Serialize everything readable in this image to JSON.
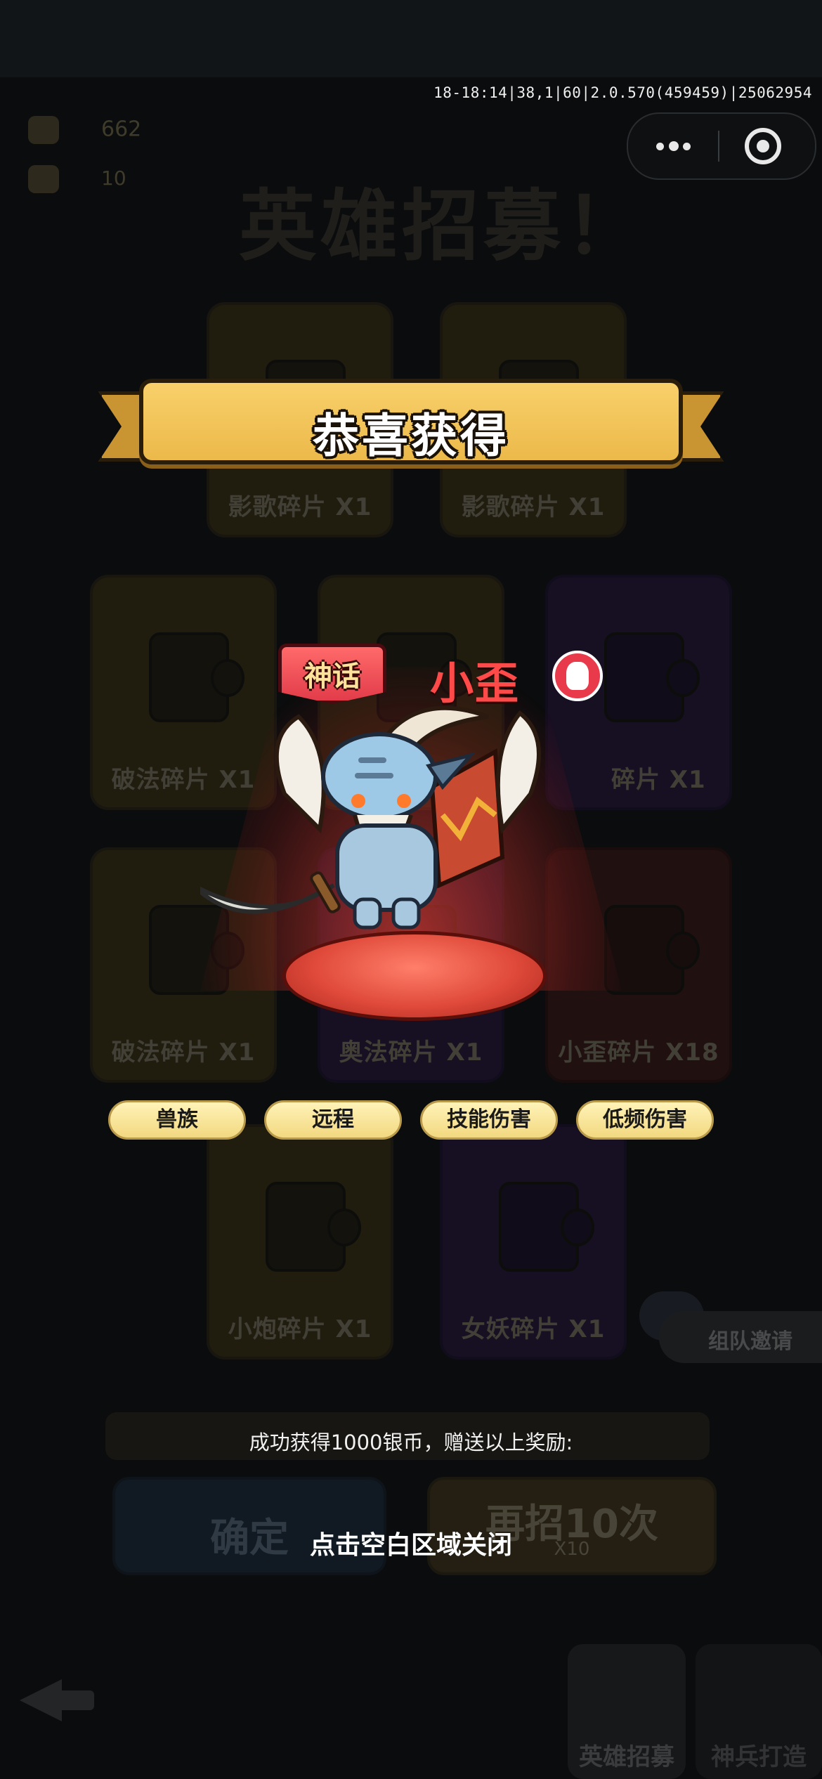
{
  "debug_info": "18-18:14|38,1|60|2.0.570(459459)|25062954",
  "capsule": {
    "more_icon": "more-dots-icon",
    "close_icon": "target-close-icon"
  },
  "background": {
    "resources": [
      {
        "icon": "gem-icon",
        "value": "662"
      },
      {
        "icon": "ticket-icon",
        "value": "10"
      }
    ],
    "title": "英雄招募！",
    "cards": [
      {
        "label": "影歌碎片 X1",
        "color": "gold"
      },
      {
        "label": "影歌碎片 X1",
        "color": "gold"
      },
      {
        "label": "破法碎片 X1",
        "color": "gold"
      },
      {
        "label": "",
        "color": "gold"
      },
      {
        "label": "碎片 X1",
        "color": "purple"
      },
      {
        "label": "破法碎片 X1",
        "color": "gold"
      },
      {
        "label": "奥法碎片 X1",
        "color": "purple"
      },
      {
        "label": "小歪碎片 X18",
        "color": "red"
      },
      {
        "label": "小炮碎片 X1",
        "color": "gold"
      },
      {
        "label": "女妖碎片 X1",
        "color": "purple"
      }
    ],
    "reward_text": "成功获得1000银币，赠送以上奖励:",
    "confirm_button": "确定",
    "recruit_again_button": "再招10次",
    "recruit_again_cost": "X10",
    "team_invite": "组队邀请",
    "nav_recruit": "英雄招募",
    "nav_other": "神兵打造"
  },
  "banner": {
    "title": "恭喜获得"
  },
  "hero": {
    "rarity": "神话",
    "name": "小歪",
    "faction_icon": "orc-skull-icon",
    "tags": [
      "兽族",
      "远程",
      "技能伤害",
      "低频伤害"
    ]
  },
  "close_hint": "点击空白区域关闭"
}
